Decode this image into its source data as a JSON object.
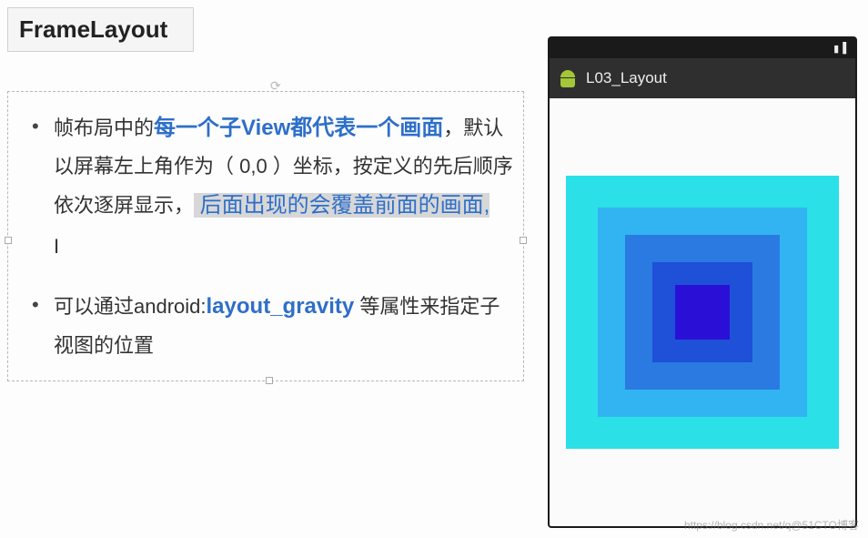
{
  "title": "FrameLayout",
  "bullets": [
    {
      "pre": "帧布局中的",
      "em1": "每一个子View都代表一个画面",
      "mid": "，默认以屏幕左上角作为（ 0,0 ）坐标，按定义的先后顺序依次逐屏显示，",
      "hl": " 后面出现的会覆盖前面的画面,"
    },
    {
      "pre": "可以通过android:",
      "em1": "layout_gravity",
      "mid": " 等属性来指定子视图的位置"
    }
  ],
  "phone": {
    "app_title": "L03_Layout",
    "squares": [
      {
        "size": 300,
        "color": "#2be0e6"
      },
      {
        "size": 230,
        "color": "#33b4f2"
      },
      {
        "size": 170,
        "color": "#2a7ae2"
      },
      {
        "size": 110,
        "color": "#1e50d8"
      },
      {
        "size": 60,
        "color": "#2a10d6"
      }
    ]
  },
  "watermark": "https://blog.csdn.net/q@51CTO博客"
}
